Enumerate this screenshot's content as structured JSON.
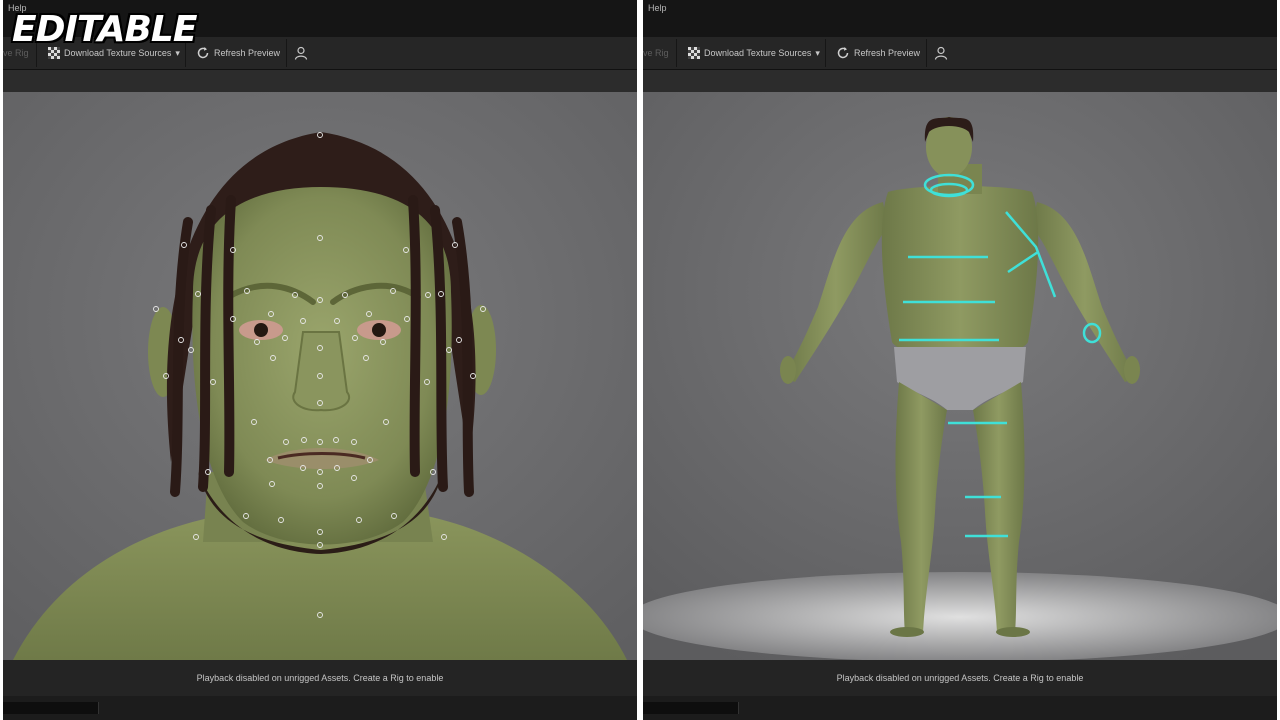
{
  "overlay": {
    "badge": "EDITABLE"
  },
  "panels": {
    "left": {
      "menu": {
        "help": "Help"
      },
      "toolbar": {
        "partial_label": "ve Rig",
        "download_textures": "Download Texture Sources",
        "refresh_preview": "Refresh Preview"
      },
      "status": "Playback disabled on unrigged Assets. Create a Rig to enable"
    },
    "right": {
      "menu": {
        "help": "Help"
      },
      "toolbar": {
        "partial_label": "ve Rig",
        "download_textures": "Download Texture Sources",
        "refresh_preview": "Refresh Preview"
      },
      "status": "Playback disabled on unrigged Assets. Create a Rig to enable"
    }
  },
  "icons": {
    "download": "checker-icon",
    "refresh": "refresh-icon",
    "user": "user-icon",
    "dropdown": "dropdown-arrow-icon"
  },
  "colors": {
    "skin": "#8e9a62",
    "hair": "#3a2520",
    "measure_lines": "#3fe0d8",
    "viewport_bg": "#6f6f71"
  }
}
